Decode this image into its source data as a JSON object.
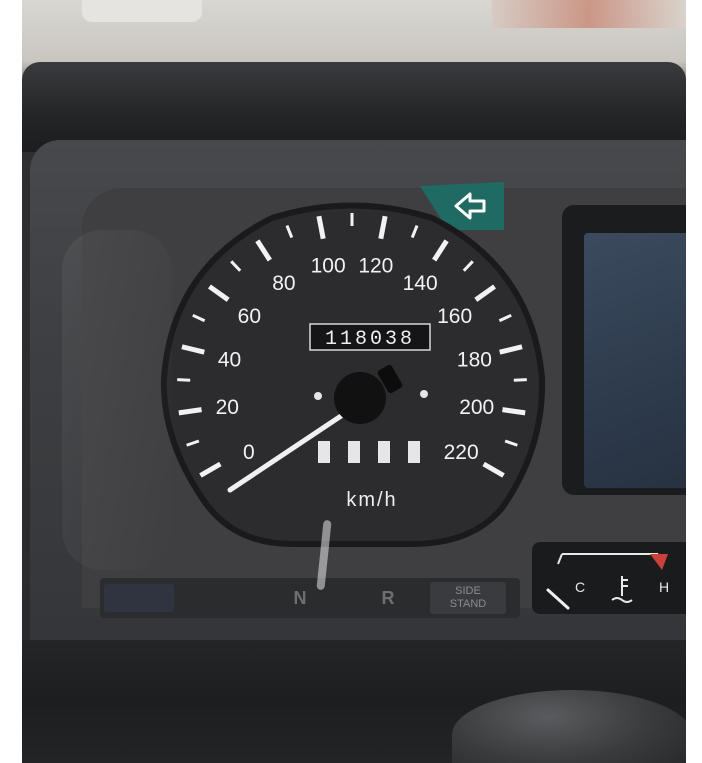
{
  "speedometer": {
    "unit": "km/h",
    "scale_labels": [
      "20",
      "40",
      "60",
      "80",
      "100",
      "120",
      "140",
      "160",
      "180",
      "200",
      "220"
    ],
    "zero_label_partial": "0",
    "odometer": "118038",
    "needle_speed_kmh": 0
  },
  "indicators": {
    "neutral": "N",
    "reverse": "R",
    "side_stand_line1": "SIDE",
    "side_stand_line2": "STAND"
  },
  "temperature_gauge": {
    "cold_label": "C",
    "hot_label": "H"
  },
  "colors": {
    "dial_face": "#2c2c2f",
    "markings": "#f2f2f2",
    "turn_signal": "#1f6a62",
    "hot_zone": "#c9413a"
  }
}
